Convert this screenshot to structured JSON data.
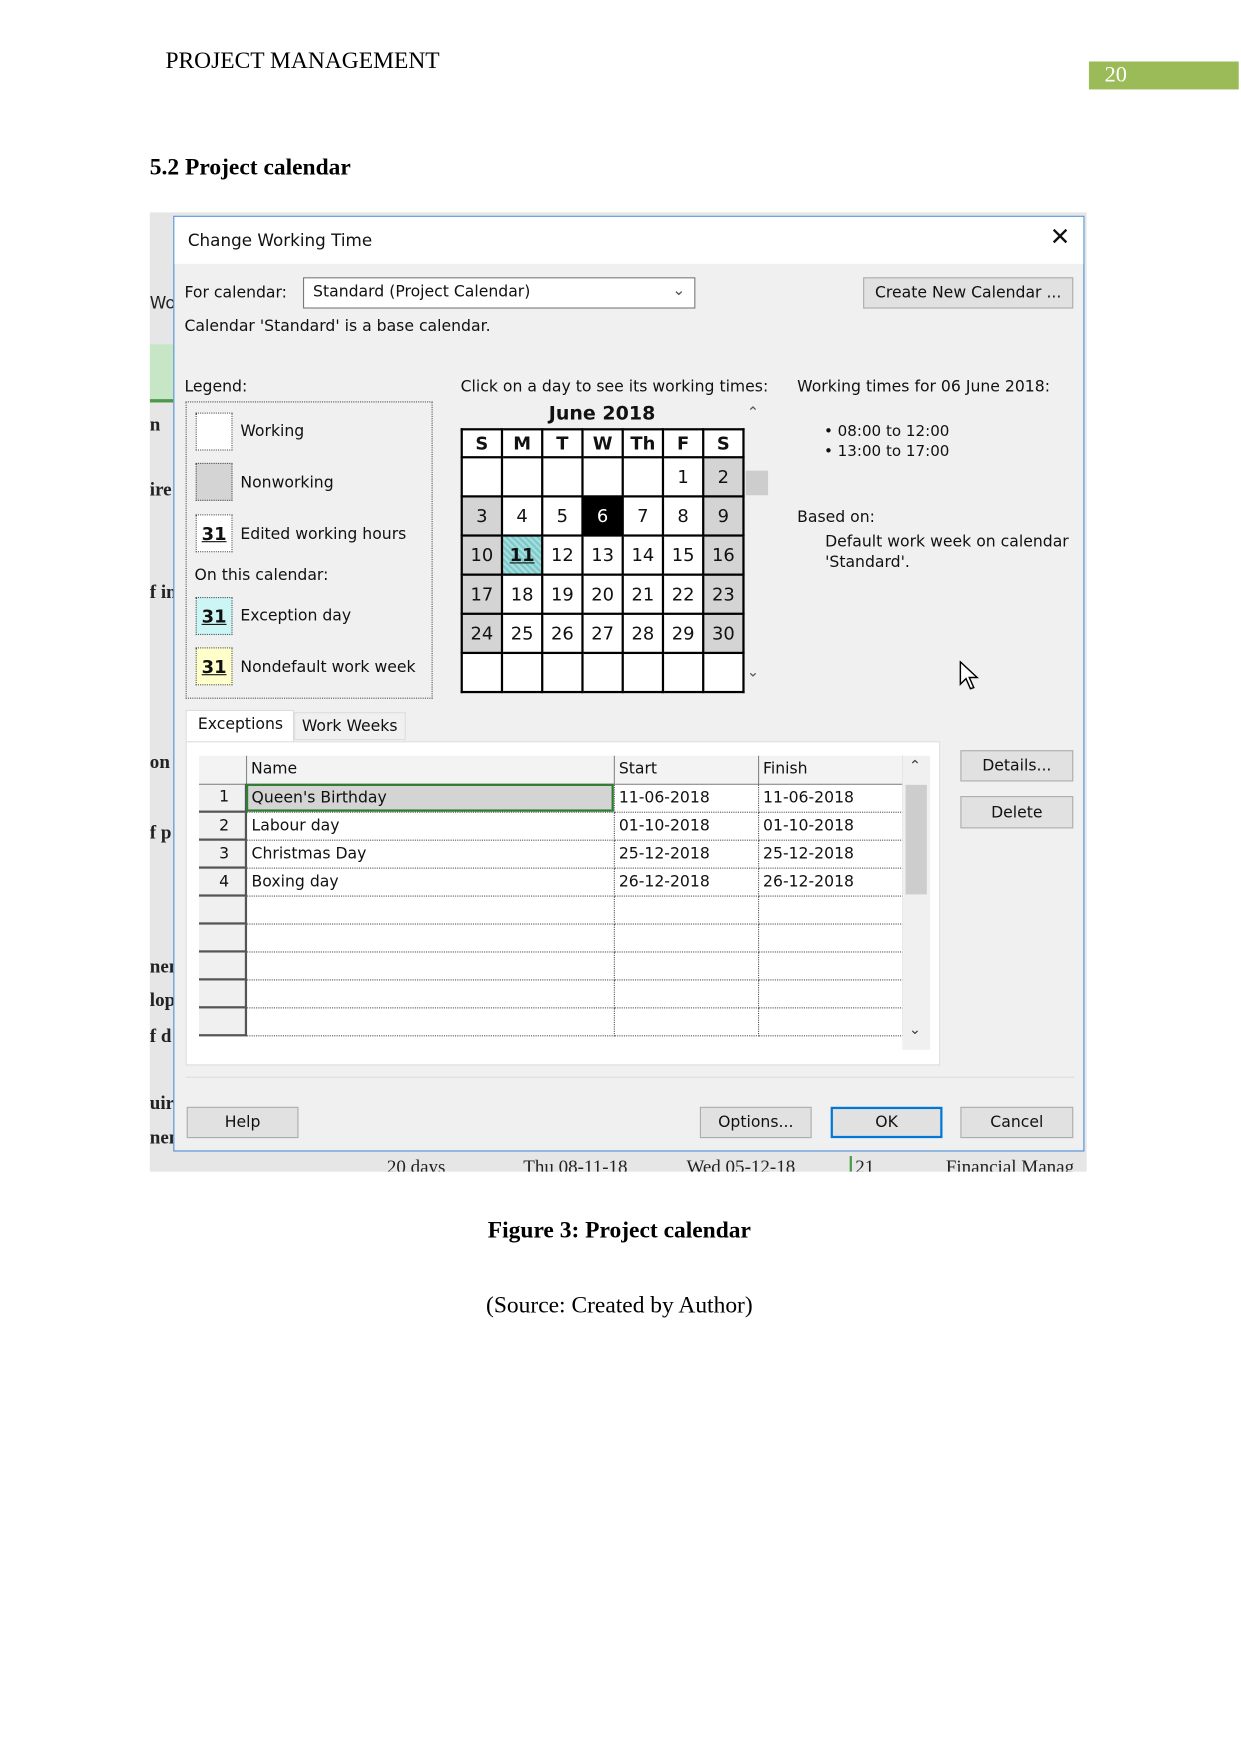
{
  "header": {
    "title": "PROJECT MANAGEMENT",
    "page_number": "20",
    "page_number_color": "#9bbb59"
  },
  "section_heading": "5.2 Project calendar",
  "background_fragments": [
    "Wo",
    "n",
    "ire",
    "f in",
    "on",
    "f p",
    "nen",
    "lop",
    "f d",
    "uir",
    "nen"
  ],
  "background_bottom": [
    "20 days",
    "Thu 08-11-18",
    "Wed 05-12-18",
    "21",
    "Financial Manag"
  ],
  "dialog": {
    "title": "Change Working Time",
    "for_calendar_label": "For calendar:",
    "calendar_select": "Standard (Project Calendar)",
    "create_new_button": "Create New Calendar ...",
    "base_note": "Calendar 'Standard' is a base calendar.",
    "legend": {
      "label": "Legend:",
      "items": [
        {
          "label": "Working",
          "swatch": ""
        },
        {
          "label": "Nonworking",
          "swatch": ""
        },
        {
          "label": "Edited working hours",
          "swatch": "31"
        }
      ],
      "on_this_calendar": "On this calendar:",
      "calendar_items": [
        {
          "label": "Exception day",
          "swatch": "31",
          "color": "#ccf5f5"
        },
        {
          "label": "Nondefault work week",
          "swatch": "31",
          "color": "#ffffcc"
        }
      ]
    },
    "click_prompt": "Click on a day to see its working times:",
    "calendar": {
      "month": "June 2018",
      "days": [
        "S",
        "M",
        "T",
        "W",
        "Th",
        "F",
        "S"
      ],
      "weeks": [
        [
          "",
          "",
          "",
          "",
          "",
          "1",
          "2"
        ],
        [
          "3",
          "4",
          "5",
          "6",
          "7",
          "8",
          "9"
        ],
        [
          "10",
          "11",
          "12",
          "13",
          "14",
          "15",
          "16"
        ],
        [
          "17",
          "18",
          "19",
          "20",
          "21",
          "22",
          "23"
        ],
        [
          "24",
          "25",
          "26",
          "27",
          "28",
          "29",
          "30"
        ],
        [
          "",
          "",
          "",
          "",
          "",
          "",
          ""
        ]
      ],
      "selected": "6",
      "exception": "11"
    },
    "working_times_title": "Working times for 06 June 2018:",
    "working_times": [
      "• 08:00 to 12:00",
      "• 13:00 to 17:00"
    ],
    "based_on_label": "Based on:",
    "based_on_text": [
      "Default work week on calendar",
      "'Standard'."
    ],
    "tabs": [
      {
        "label": "Exceptions",
        "active": true
      },
      {
        "label": "Work Weeks",
        "active": false
      }
    ],
    "table": {
      "columns": [
        "Name",
        "Start",
        "Finish"
      ],
      "rows": [
        {
          "num": "1",
          "name": "Queen's Birthday",
          "start": "11-06-2018",
          "finish": "11-06-2018"
        },
        {
          "num": "2",
          "name": "Labour day",
          "start": "01-10-2018",
          "finish": "01-10-2018"
        },
        {
          "num": "3",
          "name": "Christmas Day",
          "start": "25-12-2018",
          "finish": "25-12-2018"
        },
        {
          "num": "4",
          "name": "Boxing day",
          "start": "26-12-2018",
          "finish": "26-12-2018"
        }
      ],
      "empty_rows": 5
    },
    "details_button": "Details...",
    "delete_button": "Delete",
    "help_button": "Help",
    "options_button": "Options...",
    "ok_button": "OK",
    "cancel_button": "Cancel"
  },
  "figure_caption": "Figure 3: Project calendar",
  "figure_source": "(Source: Created by Author)"
}
